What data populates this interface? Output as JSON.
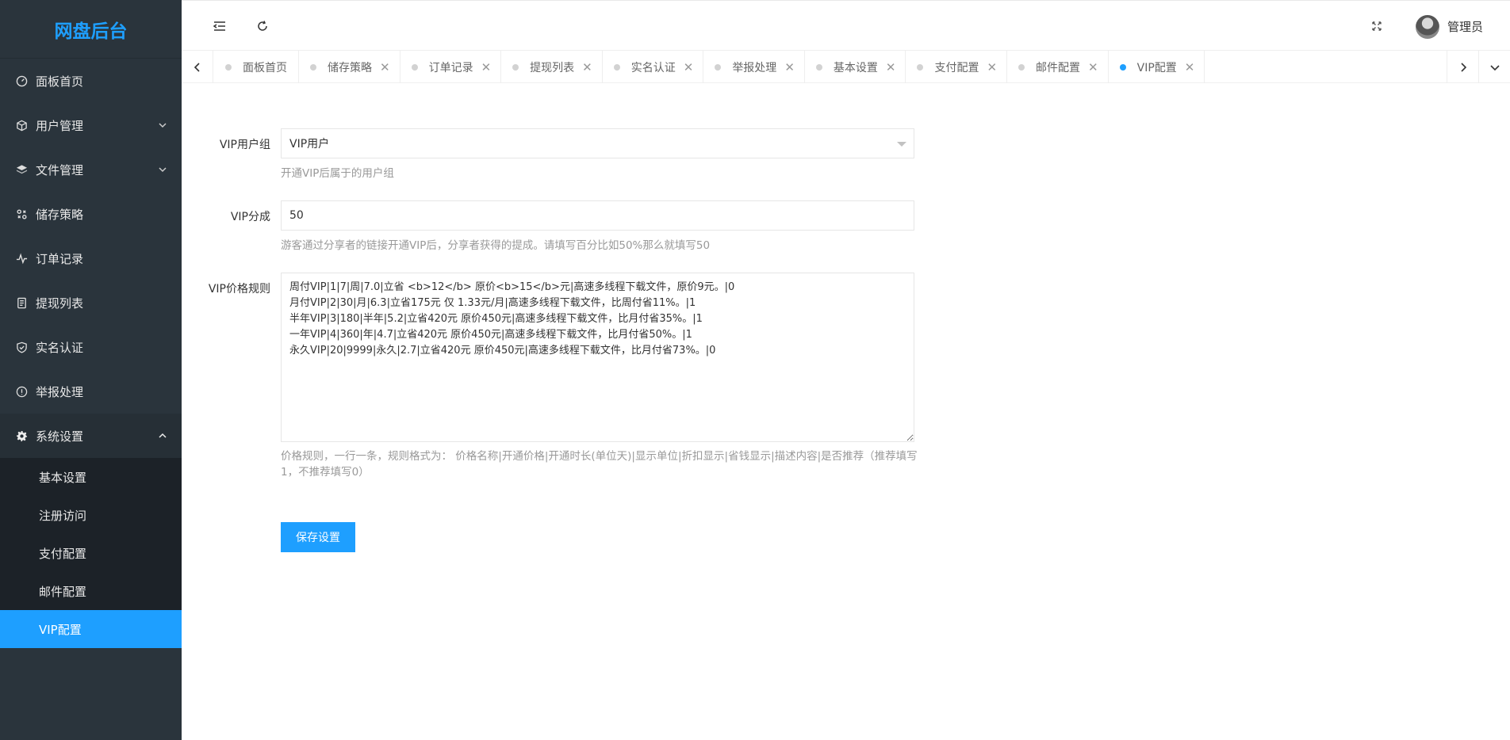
{
  "app": {
    "title": "网盘后台"
  },
  "sidebar": {
    "items": [
      {
        "label": "面板首页",
        "icon": "dashboard-icon"
      },
      {
        "label": "用户管理",
        "icon": "cube-icon",
        "expandable": true
      },
      {
        "label": "文件管理",
        "icon": "layers-icon",
        "expandable": true
      },
      {
        "label": "储存策略",
        "icon": "components-icon"
      },
      {
        "label": "订单记录",
        "icon": "activity-icon"
      },
      {
        "label": "提现列表",
        "icon": "list-doc-icon"
      },
      {
        "label": "实名认证",
        "icon": "shield-check-icon"
      },
      {
        "label": "举报处理",
        "icon": "info-circle-icon"
      },
      {
        "label": "系统设置",
        "icon": "gear-icon",
        "expanded": true
      }
    ],
    "submenu": [
      {
        "label": "基本设置"
      },
      {
        "label": "注册访问"
      },
      {
        "label": "支付配置"
      },
      {
        "label": "邮件配置"
      },
      {
        "label": "VIP配置",
        "active": true
      }
    ]
  },
  "header": {
    "user_name": "管理员"
  },
  "tabs": [
    {
      "label": "面板首页",
      "closable": false
    },
    {
      "label": "储存策略",
      "closable": true
    },
    {
      "label": "订单记录",
      "closable": true
    },
    {
      "label": "提现列表",
      "closable": true
    },
    {
      "label": "实名认证",
      "closable": true
    },
    {
      "label": "举报处理",
      "closable": true
    },
    {
      "label": "基本设置",
      "closable": true
    },
    {
      "label": "支付配置",
      "closable": true
    },
    {
      "label": "邮件配置",
      "closable": true
    },
    {
      "label": "VIP配置",
      "closable": true,
      "active": true
    }
  ],
  "tab_close_glyph": "✕",
  "form": {
    "vip_group": {
      "label": "VIP用户组",
      "value": "VIP用户",
      "help": "开通VIP后属于的用户组"
    },
    "vip_share": {
      "label": "VIP分成",
      "value": "50",
      "help": "游客通过分享者的链接开通VIP后，分享者获得的提成。请填写百分比如50%那么就填写50"
    },
    "vip_rules": {
      "label": "VIP价格规则",
      "value": "周付VIP|1|7|周|7.0|立省 <b>12</b> 原价<b>15</b>元|高速多线程下载文件，原价9元。|0\n月付VIP|2|30|月|6.3|立省175元 仅 1.33元/月|高速多线程下载文件，比周付省11%。|1\n半年VIP|3|180|半年|5.2|立省420元 原价450元|高速多线程下载文件，比月付省35%。|1\n一年VIP|4|360|年|4.7|立省420元 原价450元|高速多线程下载文件，比月付省50%。|1\n永久VIP|20|9999|永久|2.7|立省420元 原价450元|高速多线程下载文件，比月付省73%。|0",
      "help": "价格规则，一行一条，规则格式为： 价格名称|开通价格|开通时长(单位天)|显示单位|折扣显示|省钱显示|描述内容|是否推荐（推荐填写1，不推荐填写0）"
    },
    "save_label": "保存设置"
  },
  "colors": {
    "accent": "#1e9fff",
    "sidebar_bg": "#2a343c",
    "submenu_bg": "#1c2228"
  }
}
